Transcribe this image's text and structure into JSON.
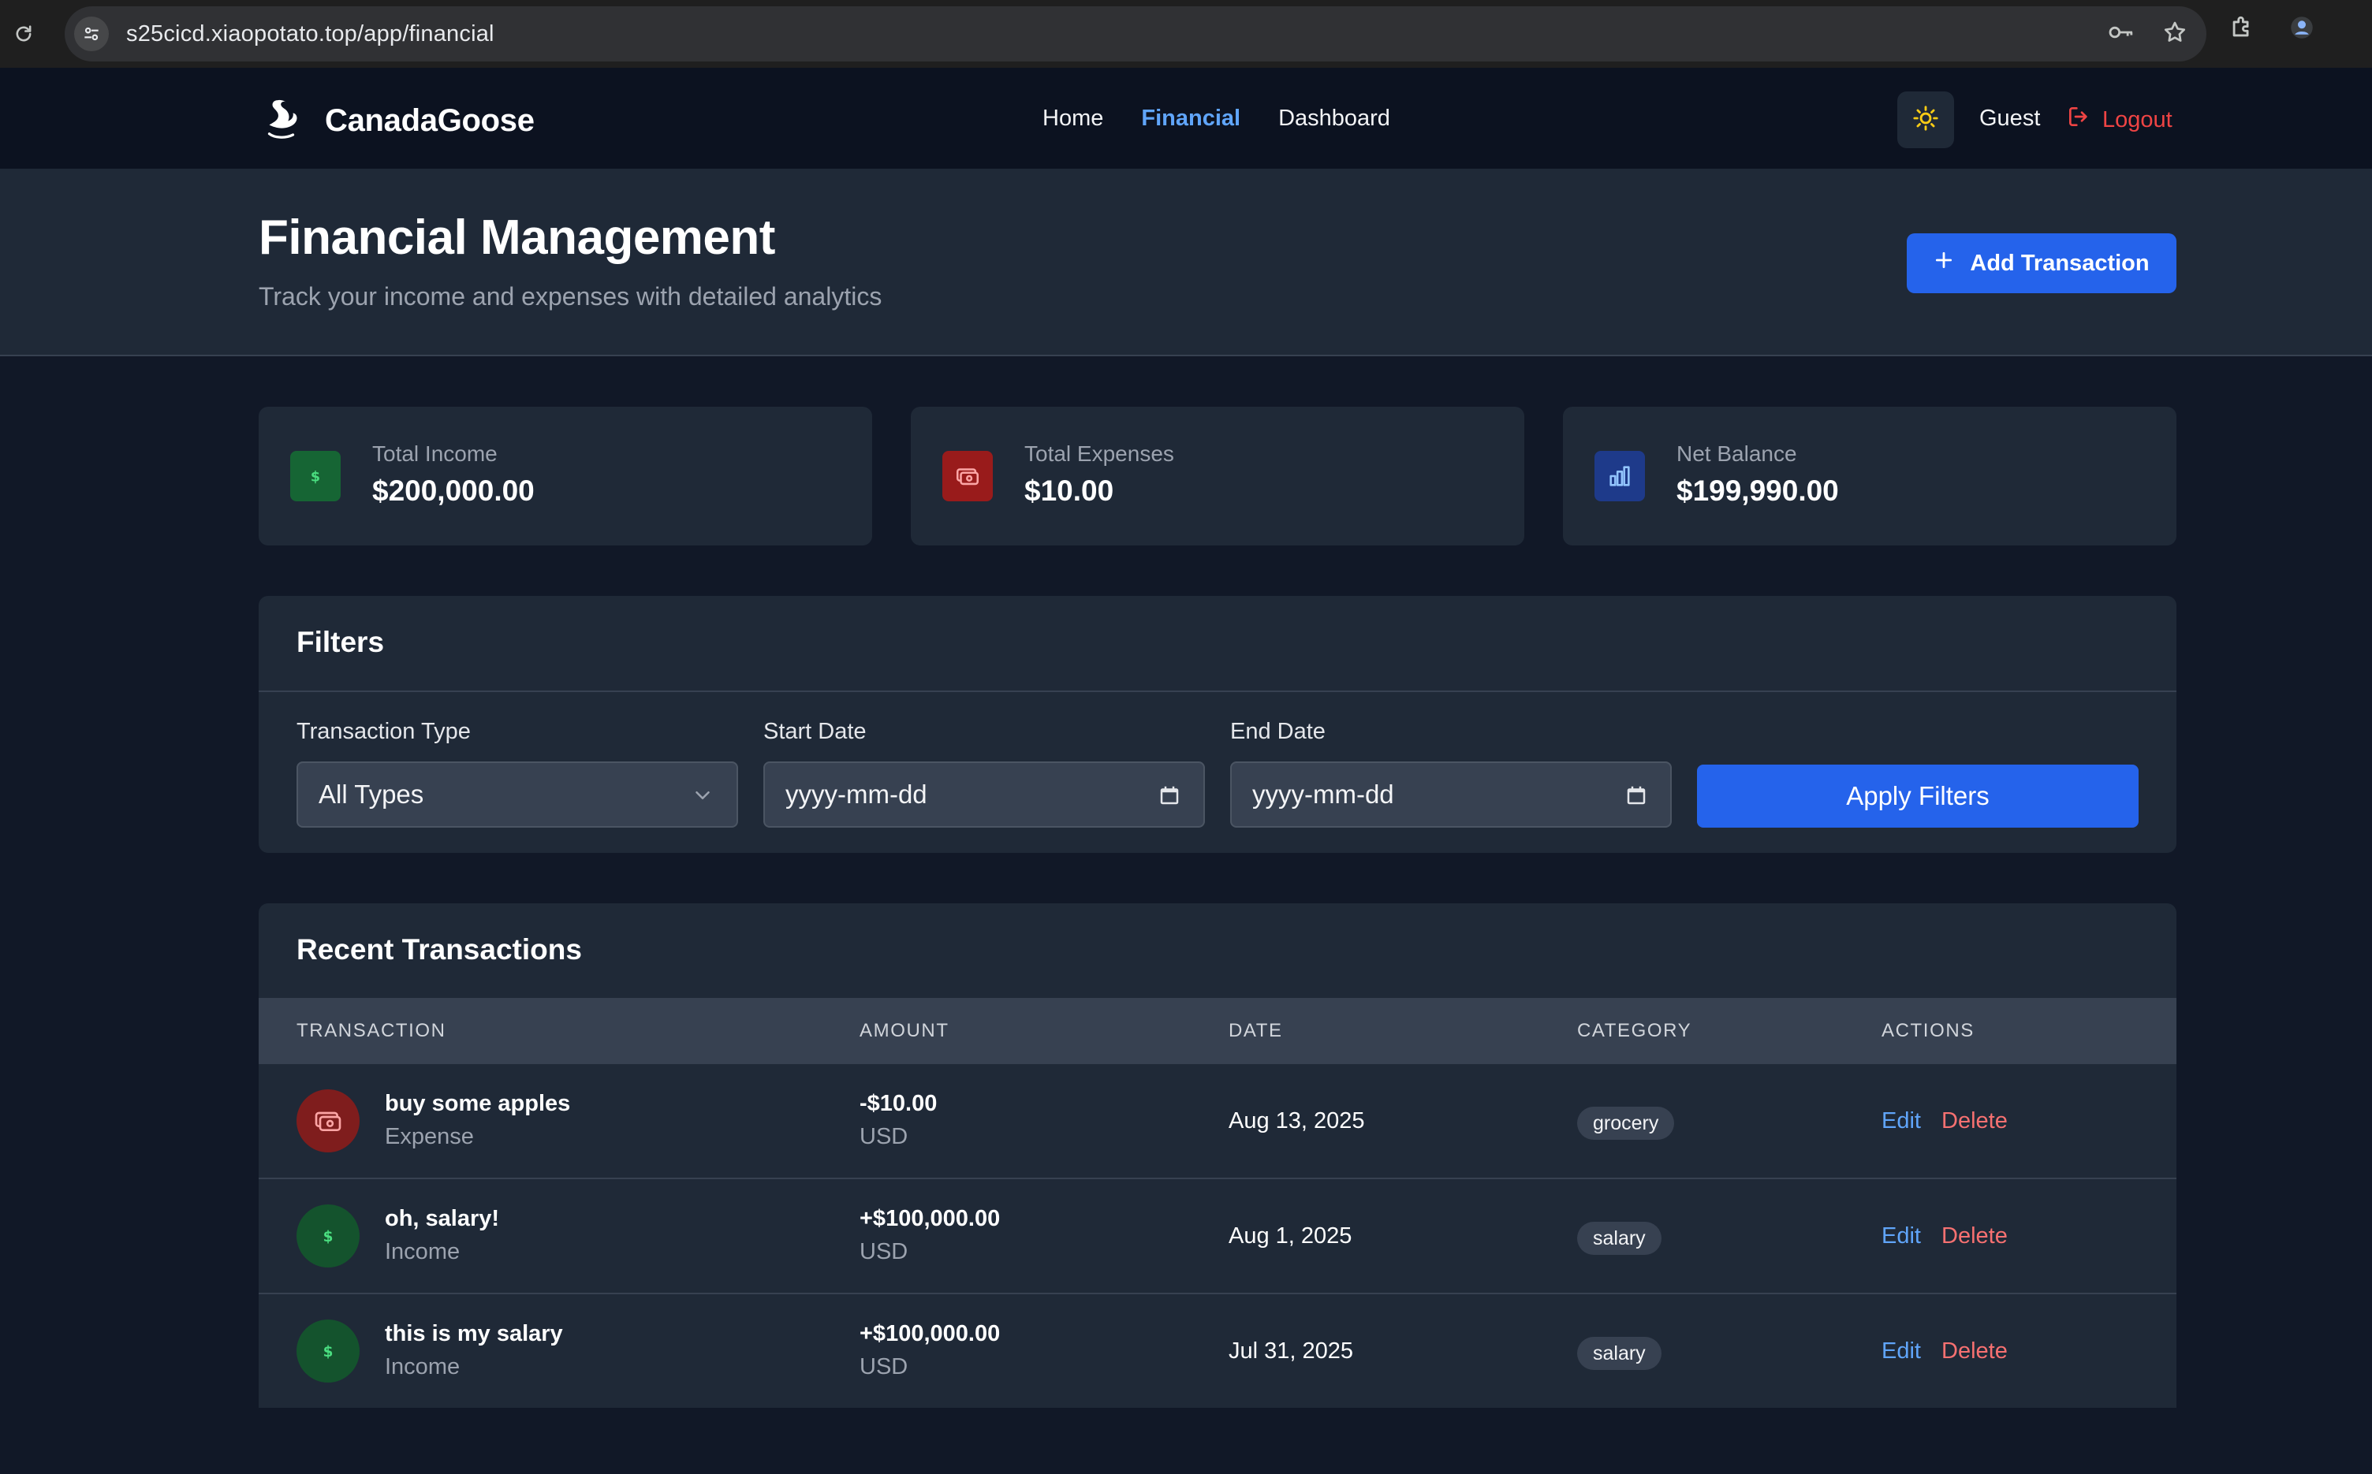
{
  "browser": {
    "url": "s25cicd.xiaopotato.top/app/financial"
  },
  "nav": {
    "brand": "CanadaGoose",
    "links": [
      "Home",
      "Financial",
      "Dashboard"
    ],
    "active": "Financial",
    "user": "Guest",
    "logout": "Logout"
  },
  "header": {
    "title": "Financial Management",
    "subtitle": "Track your income and expenses with detailed analytics",
    "add_button": "Add Transaction"
  },
  "stats": [
    {
      "label": "Total Income",
      "value": "$200,000.00",
      "icon": "dollar-icon",
      "color": "#166534"
    },
    {
      "label": "Total Expenses",
      "value": "$10.00",
      "icon": "cash-icon",
      "color": "#991b1b"
    },
    {
      "label": "Net Balance",
      "value": "$199,990.00",
      "icon": "bar-chart-icon",
      "color": "#1e3a8a"
    }
  ],
  "filters": {
    "title": "Filters",
    "type_label": "Transaction Type",
    "type_value": "All Types",
    "start_label": "Start Date",
    "start_placeholder": "yyyy-mm-dd",
    "end_label": "End Date",
    "end_placeholder": "yyyy-mm-dd",
    "apply": "Apply Filters"
  },
  "transactions": {
    "title": "Recent Transactions",
    "columns": [
      "TRANSACTION",
      "AMOUNT",
      "DATE",
      "CATEGORY",
      "ACTIONS"
    ],
    "edit_label": "Edit",
    "delete_label": "Delete",
    "rows": [
      {
        "name": "buy some apples",
        "type": "Expense",
        "amount": "-$10.00",
        "currency": "USD",
        "date": "Aug 13, 2025",
        "category": "grocery"
      },
      {
        "name": "oh, salary!",
        "type": "Income",
        "amount": "+$100,000.00",
        "currency": "USD",
        "date": "Aug 1, 2025",
        "category": "salary"
      },
      {
        "name": "this is my salary",
        "type": "Income",
        "amount": "+$100,000.00",
        "currency": "USD",
        "date": "Jul 31, 2025",
        "category": "salary"
      }
    ]
  },
  "colors": {
    "primary": "#2563eb",
    "link_active": "#60a5fa",
    "danger": "#ef4444",
    "income_green": "#4ade80"
  }
}
